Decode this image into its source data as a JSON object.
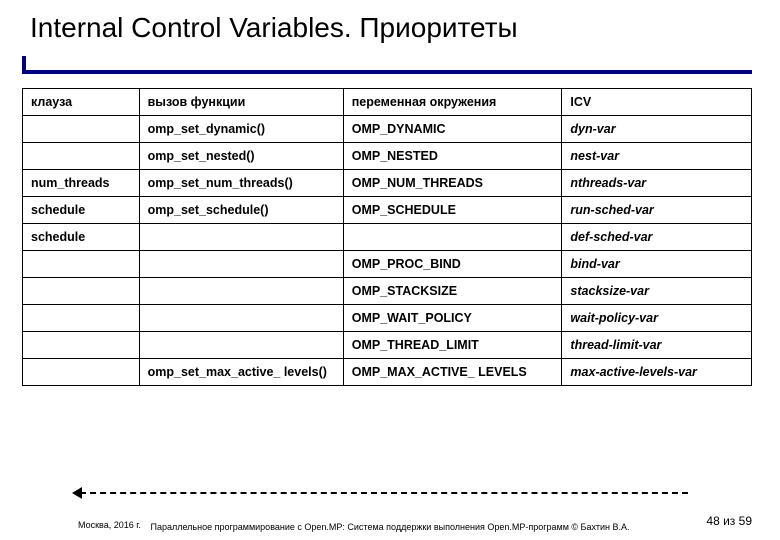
{
  "title": "Internal Control Variables. Приоритеты",
  "headers": {
    "c1": "клауза",
    "c2": "вызов функции",
    "c3": "переменная окружения",
    "c4": "ICV"
  },
  "rows": [
    {
      "c1": "",
      "c2": "omp_set_dynamic()",
      "c3": "OMP_DYNAMIC",
      "c4": "dyn-var"
    },
    {
      "c1": "",
      "c2": "omp_set_nested()",
      "c3": "OMP_NESTED",
      "c4": "nest-var"
    },
    {
      "c1": "num_threads",
      "c2": "omp_set_num_threads()",
      "c3": "OMP_NUM_THREADS",
      "c4": "nthreads-var"
    },
    {
      "c1": "schedule",
      "c2": "omp_set_schedule()",
      "c3": "OMP_SCHEDULE",
      "c4": "run-sched-var"
    },
    {
      "c1": "schedule",
      "c2": "",
      "c3": "",
      "c4": "def-sched-var"
    },
    {
      "c1": "",
      "c2": "",
      "c3": "OMP_PROC_BIND",
      "c4": "bind-var"
    },
    {
      "c1": "",
      "c2": "",
      "c3": "OMP_STACKSIZE",
      "c4": "stacksize-var"
    },
    {
      "c1": "",
      "c2": "",
      "c3": "OMP_WAIT_POLICY",
      "c4": "wait-policy-var"
    },
    {
      "c1": "",
      "c2": "",
      "c3": "OMP_THREAD_LIMIT",
      "c4": "thread-limit-var"
    },
    {
      "c1": "",
      "c2": "omp_set_max_active_ levels()",
      "c3": "OMP_MAX_ACTIVE_ LEVELS",
      "c4": "max-active-levels-var"
    }
  ],
  "footer": {
    "left": "Москва, 2016 г.",
    "center": "Параллельное программирование с Open.MP: Система поддержки выполнения Open.MP-программ © Бахтин В.А.",
    "right": "48 из 59"
  }
}
